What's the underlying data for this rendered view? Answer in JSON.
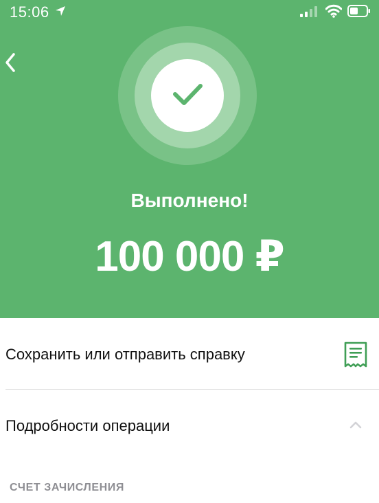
{
  "status": {
    "time": "15:06"
  },
  "hero": {
    "title": "Выполнено!",
    "amount": "100 000 ₽"
  },
  "actions": {
    "save_label": "Сохранить или отправить справку",
    "details_label": "Подробности операции"
  },
  "section": {
    "title": "СЧЕТ ЗАЧИСЛЕНИЯ"
  },
  "icons": {
    "back": "chevron-left-icon",
    "success": "checkmark-icon",
    "receipt": "document-icon",
    "expand": "chevron-up-icon"
  },
  "colors": {
    "brand_green": "#5cb46e",
    "ring_outer": "#79c287",
    "ring_inner": "#a3d6ac",
    "check": "#5cb46e"
  }
}
